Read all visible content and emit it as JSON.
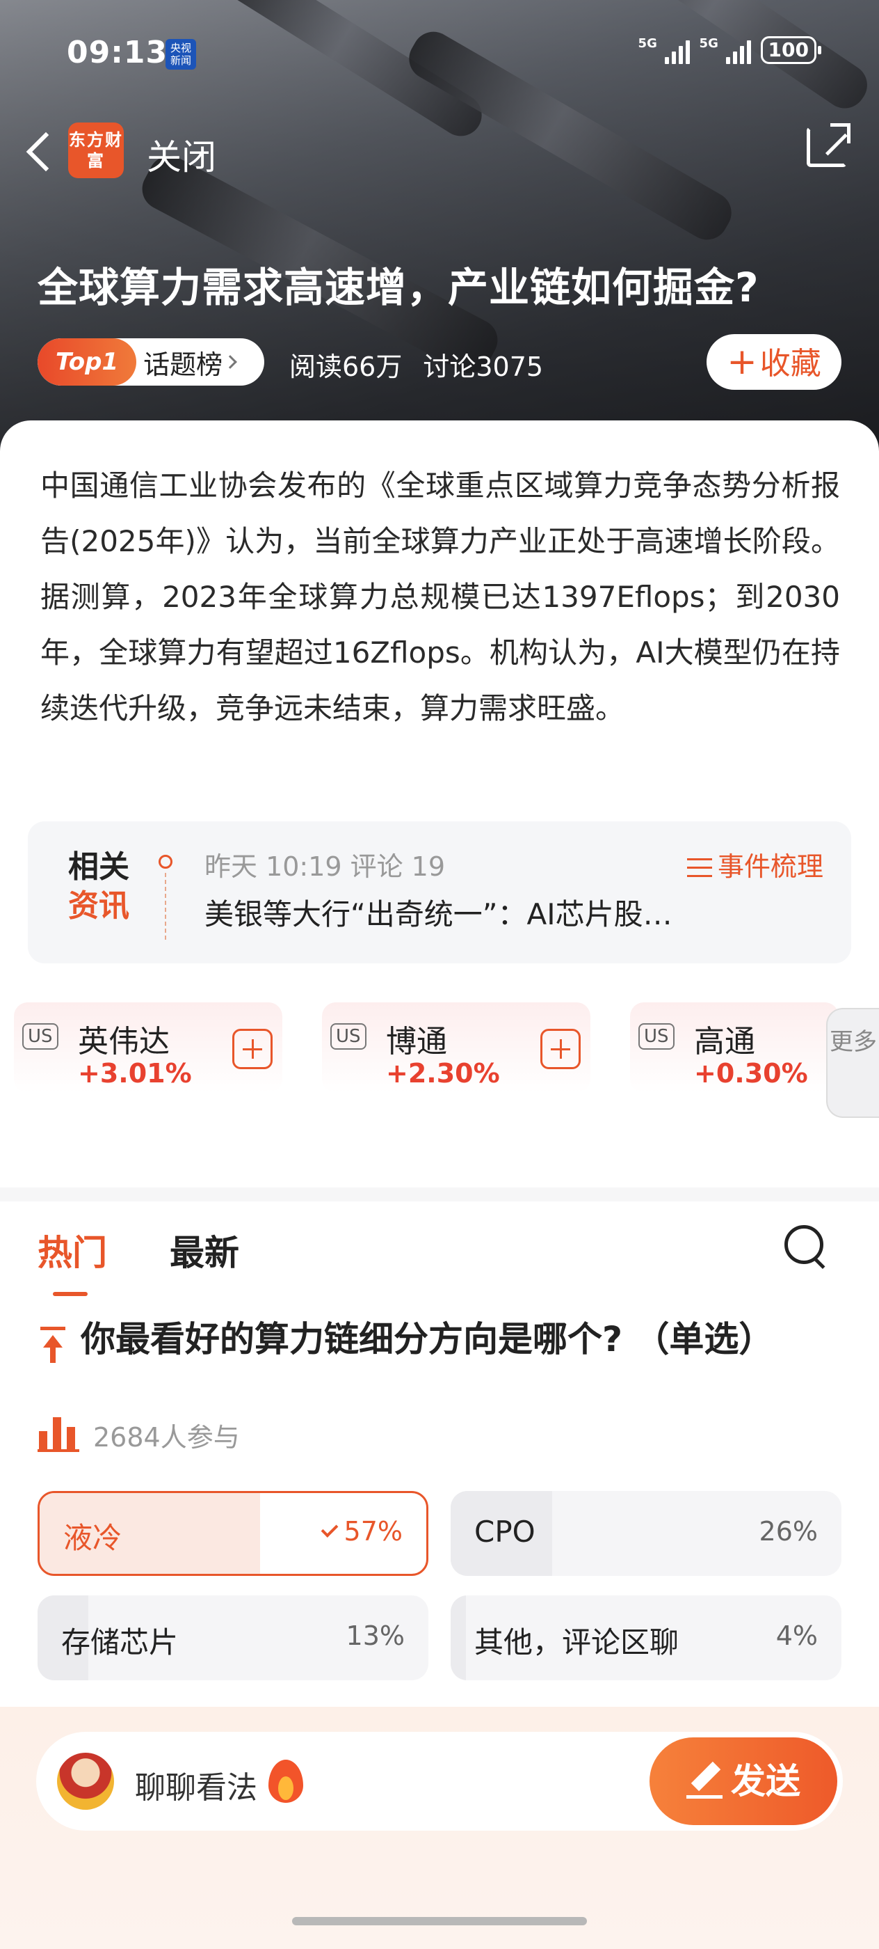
{
  "status_bar": {
    "time": "09:13",
    "cctv_badge": "央视新闻",
    "signal1": "5G",
    "signal2": "5G",
    "battery": "100"
  },
  "nav": {
    "logo_text": "东方财富",
    "close_label": "关闭"
  },
  "topic": {
    "title": "全球算力需求高速增，产业链如何掘金?",
    "rank_badge": "Top1",
    "rank_label": "话题榜",
    "reads": "阅读66万",
    "discussions": "讨论3075",
    "favorite_label": "收藏",
    "description": "中国通信工业协会发布的《全球重点区域算力竞争态势分析报告(2025年)》认为，当前全球算力产业正处于高速增长阶段。据测算，2023年全球算力总规模已达1397Eflops；到2030年，全球算力有望超过16Zflops。机构认为，AI大模型仍在持续迭代升级，竞争远未结束，算力需求旺盛。"
  },
  "related": {
    "badge_line1": "相关",
    "badge_line2": "资讯",
    "time": "昨天 10:19",
    "comments": "评论 19",
    "events_label": "事件梳理",
    "headline": "美银等大行“出奇统一”：AI芯片股…"
  },
  "stocks": [
    {
      "market": "US",
      "name": "英伟达",
      "change": "+3.01%"
    },
    {
      "market": "US",
      "name": "博通",
      "change": "+2.30%"
    },
    {
      "market": "US",
      "name": "高通",
      "change": "+0.30%"
    }
  ],
  "more_label": "更多",
  "tabs": {
    "hot": "热门",
    "latest": "最新"
  },
  "poll": {
    "question": "你最看好的算力链细分方向是哪个? （单选）",
    "participants": "2684人参与",
    "options": [
      {
        "label": "液冷",
        "percent": "57%",
        "share": 0.57,
        "selected": true
      },
      {
        "label": "CPO",
        "percent": "26%",
        "share": 0.26,
        "selected": false
      },
      {
        "label": "存储芯片",
        "percent": "13%",
        "share": 0.13,
        "selected": false
      },
      {
        "label": "其他，评论区聊",
        "percent": "4%",
        "share": 0.04,
        "selected": false
      }
    ]
  },
  "composer": {
    "placeholder": "聊聊看法",
    "send_label": "发送"
  },
  "colors": {
    "accent": "#e8562a",
    "rise": "#e8412f"
  }
}
